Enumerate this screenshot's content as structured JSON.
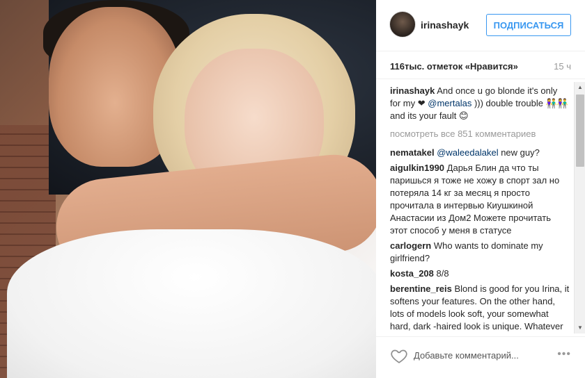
{
  "post": {
    "username": "irinashayk",
    "follow_label": "ПОДПИСАТЬСЯ",
    "likes": "116тыс. отметок «Нравится»",
    "time": "15 ч"
  },
  "caption": {
    "user": "irinashayk",
    "text_before": "And once u go blonde it's only for my",
    "heart": "❤",
    "mention": "@mertalas",
    "text_after": "))) double trouble 👫👫 and its your fault 😊"
  },
  "view_all": "посмотреть все 851 комментариев",
  "comments": [
    {
      "user": "nematakel",
      "mention": "@waleedalakel",
      "text": "new guy?"
    },
    {
      "user": "aigulkin1990",
      "mention": "",
      "text": "Дарья Блин да что ты паришься я тоже не хожу в спорт зал но потеряла 14 кг за месяц я просто прочитала в интервью Киушкиной Анастасии из Дом2 Можете прочитать этот способ у меня в статусе"
    },
    {
      "user": "carlogern",
      "mention": "",
      "text": "Who wants to dominate my girlfriend?"
    },
    {
      "user": "kosta_208",
      "mention": "",
      "text": "8/8"
    },
    {
      "user": "berentine_reis",
      "mention": "",
      "text": "Blond is good for you Irina, it softens your features. On the other hand, lots of models look soft, your somewhat hard, dark -haired look is unique. Whatever you decide, you are"
    }
  ],
  "add_comment": {
    "placeholder": "Добавьте комментарий...",
    "more": "•••"
  },
  "icons": {
    "heart": "heart-outline-icon",
    "more": "more-options-icon",
    "scroll_up": "scroll-up-arrow-icon",
    "scroll_down": "scroll-down-arrow-icon",
    "tattoo": "anchor-icon"
  },
  "colors": {
    "accent": "#3897f0",
    "muted": "#999999",
    "mention": "#003569"
  }
}
